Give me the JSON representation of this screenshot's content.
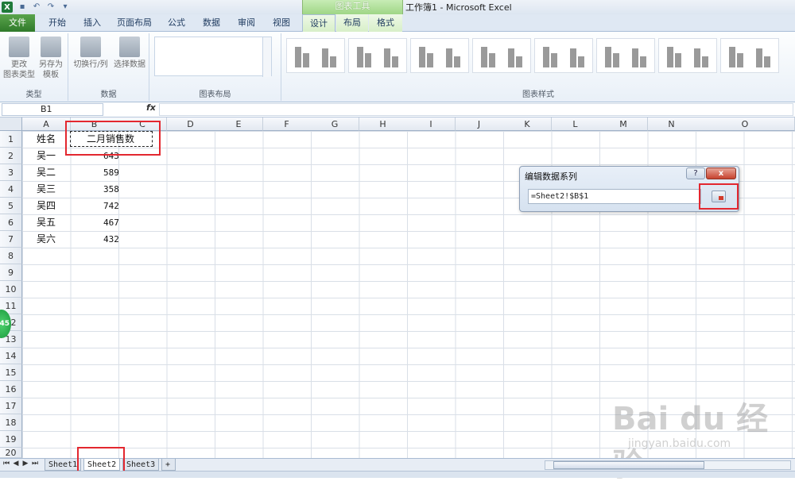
{
  "window": {
    "title": "工作簿1 - Microsoft Excel",
    "contextual_tab_group": "图表工具"
  },
  "ribbon": {
    "tabs": [
      "文件",
      "开始",
      "插入",
      "页面布局",
      "公式",
      "数据",
      "审阅",
      "视图",
      "设计",
      "布局",
      "格式"
    ],
    "active_tab": "设计",
    "groups": {
      "type": {
        "label": "类型",
        "buttons": [
          "更改\n图表类型",
          "另存为\n模板"
        ]
      },
      "data": {
        "label": "数据",
        "buttons": [
          "切换行/列",
          "选择数据"
        ]
      },
      "layout": {
        "label": "图表布局"
      },
      "styles": {
        "label": "图表样式"
      }
    }
  },
  "formula_bar": {
    "name_box": "B1",
    "fx": "fx",
    "formula": ""
  },
  "grid": {
    "columns": [
      "A",
      "B",
      "C",
      "D",
      "E",
      "F",
      "G",
      "H",
      "I",
      "J",
      "K",
      "L",
      "M",
      "N",
      "O"
    ],
    "rows": [
      "1",
      "2",
      "3",
      "4",
      "5",
      "6",
      "7",
      "8",
      "9",
      "10",
      "11",
      "12",
      "13",
      "14",
      "15",
      "16",
      "17",
      "18",
      "19",
      "20"
    ],
    "header": {
      "name": "姓名",
      "value": "二月销售数"
    },
    "records": [
      {
        "name": "吴一",
        "value": "643"
      },
      {
        "name": "吴二",
        "value": "589"
      },
      {
        "name": "吴三",
        "value": "358"
      },
      {
        "name": "吴四",
        "value": "742"
      },
      {
        "name": "吴五",
        "value": "467"
      },
      {
        "name": "吴六",
        "value": "432"
      }
    ]
  },
  "dialog": {
    "title": "编辑数据系列",
    "help": "?",
    "close": "x",
    "series_ref": "=Sheet2!$B$1"
  },
  "sheet_tabs": [
    "Sheet1",
    "Sheet2",
    "Sheet3"
  ],
  "active_sheet": "Sheet2",
  "overlay": {
    "bubble": "45",
    "watermark": "Bai du 经验",
    "watermark_url": "jingyan.baidu.com"
  }
}
